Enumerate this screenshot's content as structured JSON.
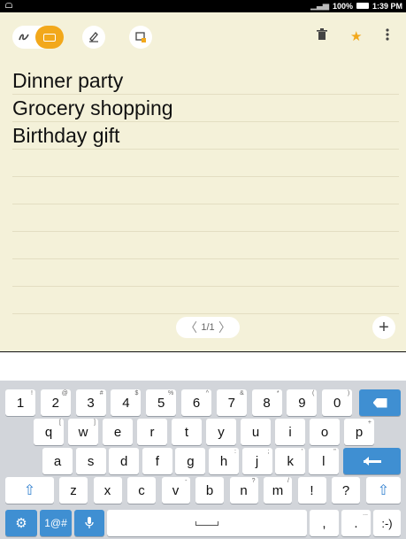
{
  "status": {
    "battery": "100%",
    "time": "1:39 PM"
  },
  "toolbar": {
    "icons": [
      "handwriting-icon",
      "keyboard-icon",
      "draw-icon",
      "crop-icon",
      "trash-icon",
      "pin-icon",
      "more-icon"
    ]
  },
  "note": {
    "lines": [
      "Dinner party",
      "Grocery shopping",
      "Birthday gift"
    ]
  },
  "pager": {
    "label": "1/1"
  },
  "add_label": "+",
  "keyboard": {
    "row1": [
      {
        "k": "1",
        "a": "!"
      },
      {
        "k": "2",
        "a": "@"
      },
      {
        "k": "3",
        "a": "#"
      },
      {
        "k": "4",
        "a": "$"
      },
      {
        "k": "5",
        "a": "%"
      },
      {
        "k": "6",
        "a": "^"
      },
      {
        "k": "7",
        "a": "&"
      },
      {
        "k": "8",
        "a": "*"
      },
      {
        "k": "9",
        "a": "("
      },
      {
        "k": "0",
        "a": ")"
      }
    ],
    "row2": [
      {
        "k": "q",
        "a": "["
      },
      {
        "k": "w",
        "a": "]"
      },
      {
        "k": "e",
        "a": ""
      },
      {
        "k": "r",
        "a": ""
      },
      {
        "k": "t",
        "a": ""
      },
      {
        "k": "y",
        "a": ""
      },
      {
        "k": "u",
        "a": ""
      },
      {
        "k": "i",
        "a": ""
      },
      {
        "k": "o",
        "a": ""
      },
      {
        "k": "p",
        "a": "+"
      }
    ],
    "row3": [
      {
        "k": "a",
        "a": ""
      },
      {
        "k": "s",
        "a": ""
      },
      {
        "k": "d",
        "a": ""
      },
      {
        "k": "f",
        "a": ""
      },
      {
        "k": "g",
        "a": ""
      },
      {
        "k": "h",
        "a": ":"
      },
      {
        "k": "j",
        "a": ";"
      },
      {
        "k": "k",
        "a": "'"
      },
      {
        "k": "l",
        "a": "\""
      }
    ],
    "row4": [
      {
        "k": "z",
        "a": ""
      },
      {
        "k": "x",
        "a": ""
      },
      {
        "k": "c",
        "a": ""
      },
      {
        "k": "v",
        "a": "-"
      },
      {
        "k": "b",
        "a": ""
      },
      {
        "k": "n",
        "a": "?"
      },
      {
        "k": "m",
        "a": "/"
      },
      {
        "k": "!",
        "a": ""
      },
      {
        "k": "?",
        "a": ""
      }
    ],
    "sym_label": "1@#",
    "comma": ",",
    "period": ".",
    "period_alt": "...",
    "smiley": ":-)"
  }
}
